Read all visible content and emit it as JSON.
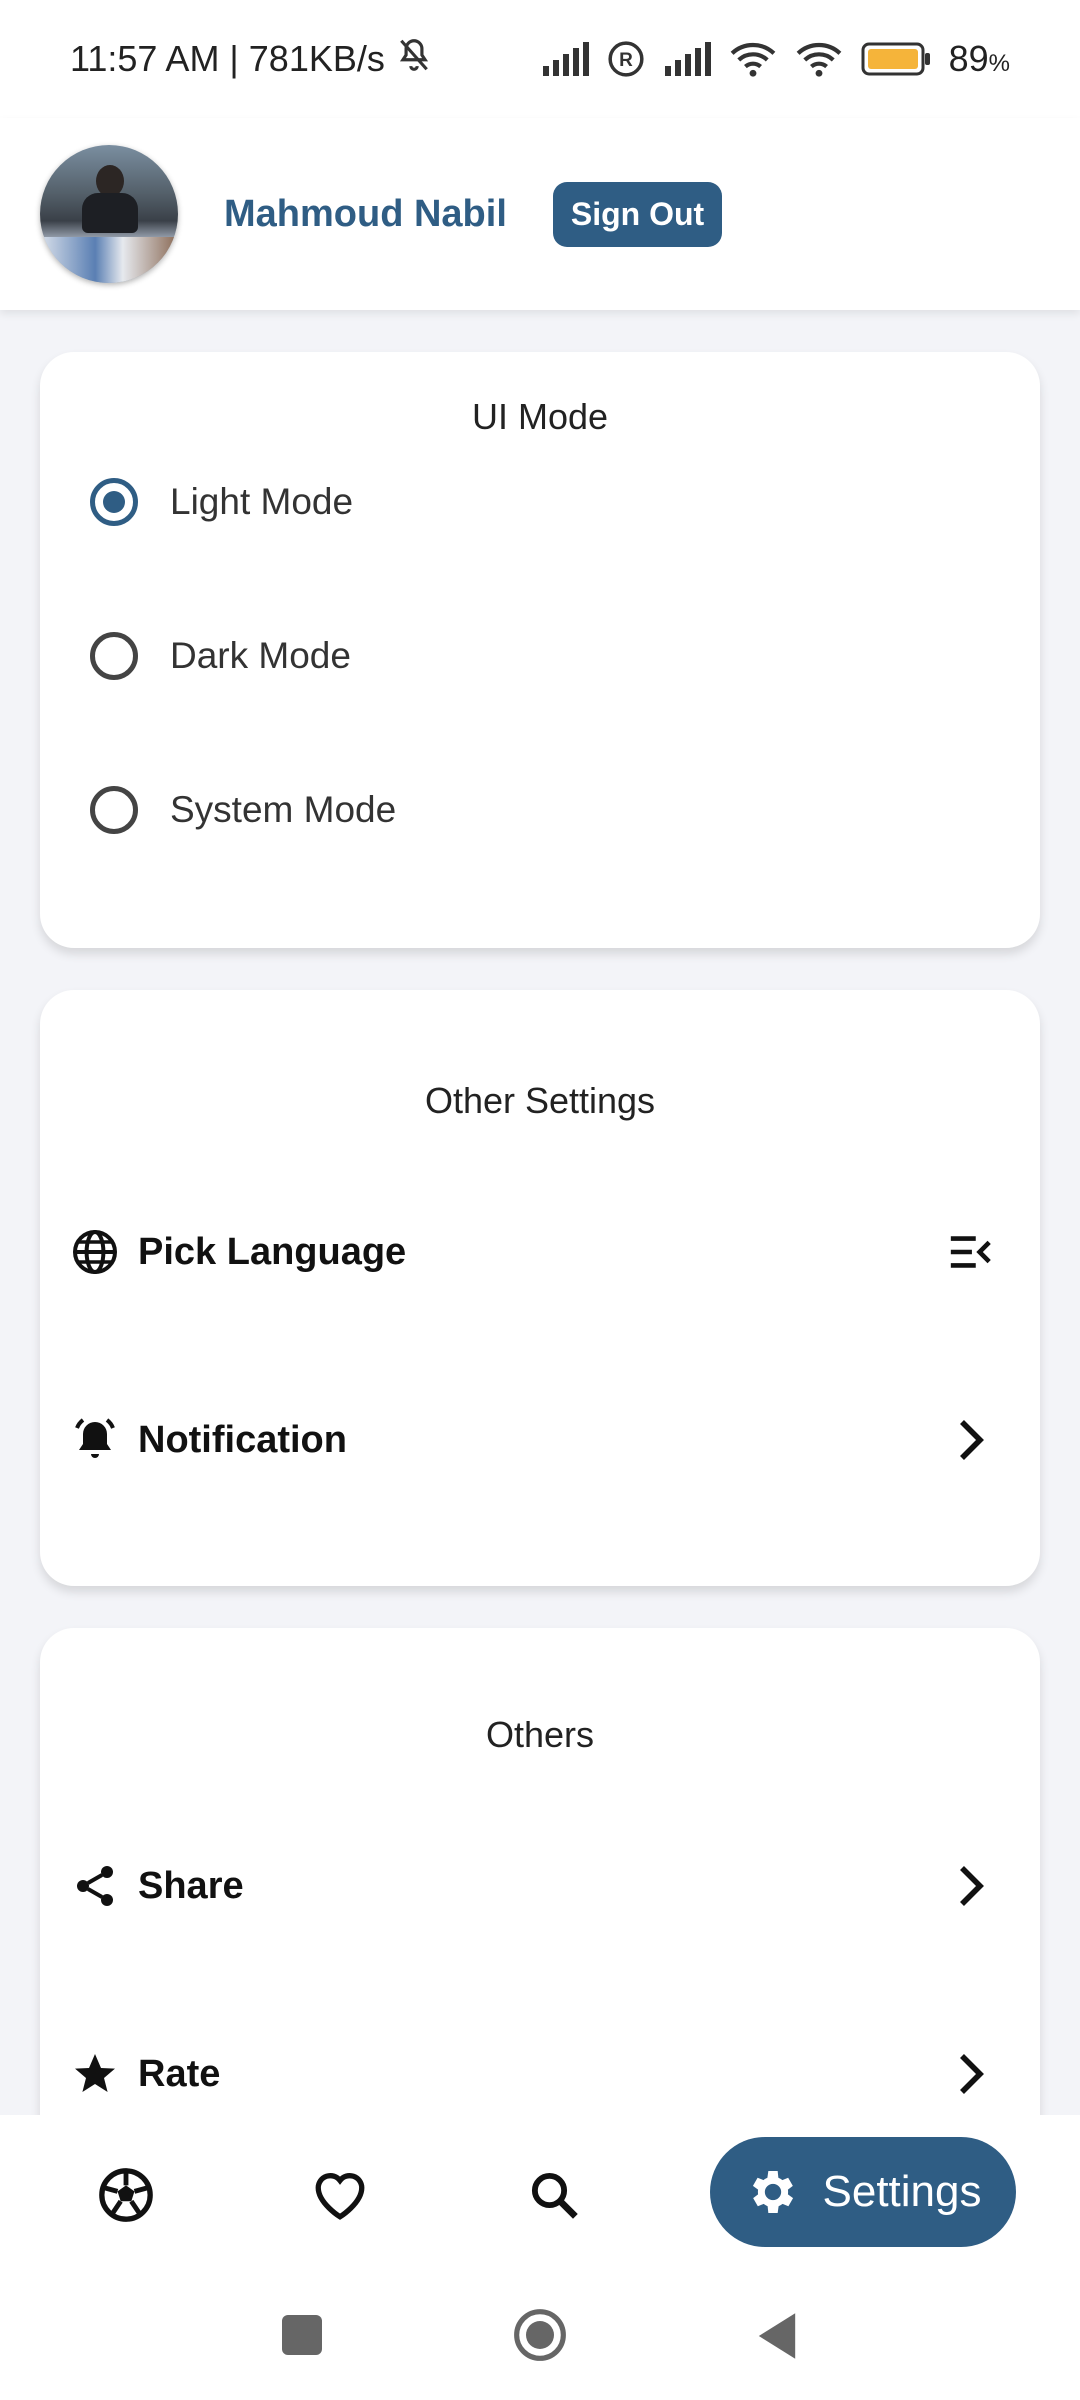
{
  "status_bar": {
    "time_speed": "11:57 AM | 781KB/s",
    "battery": "89",
    "battery_unit": "%",
    "battery_color": "#f5b43a"
  },
  "header": {
    "username": "Mahmoud Nabil",
    "sign_out_label": "Sign Out",
    "accent": "#2f5d84"
  },
  "ui_mode": {
    "title": "UI Mode",
    "options": [
      {
        "label": "Light Mode",
        "selected": true
      },
      {
        "label": "Dark Mode",
        "selected": false
      },
      {
        "label": "System Mode",
        "selected": false
      }
    ]
  },
  "other_settings": {
    "title": "Other Settings",
    "items": [
      {
        "label": "Pick Language",
        "icon": "globe-icon",
        "trailing": "menu-collapse-icon"
      },
      {
        "label": "Notification",
        "icon": "bell-icon",
        "trailing": "chevron-right-icon"
      }
    ]
  },
  "others": {
    "title": "Others",
    "items": [
      {
        "label": "Share",
        "icon": "share-icon",
        "trailing": "chevron-right-icon"
      },
      {
        "label": "Rate",
        "icon": "star-icon",
        "trailing": "chevron-right-icon"
      }
    ]
  },
  "bottom_nav": {
    "items": [
      {
        "icon": "soccer-ball-icon"
      },
      {
        "icon": "heart-icon"
      },
      {
        "icon": "search-icon"
      },
      {
        "icon": "gear-icon",
        "label": "Settings",
        "active": true
      }
    ]
  },
  "system_nav": {
    "items": [
      "recents-square-icon",
      "home-circle-icon",
      "back-triangle-icon"
    ]
  }
}
